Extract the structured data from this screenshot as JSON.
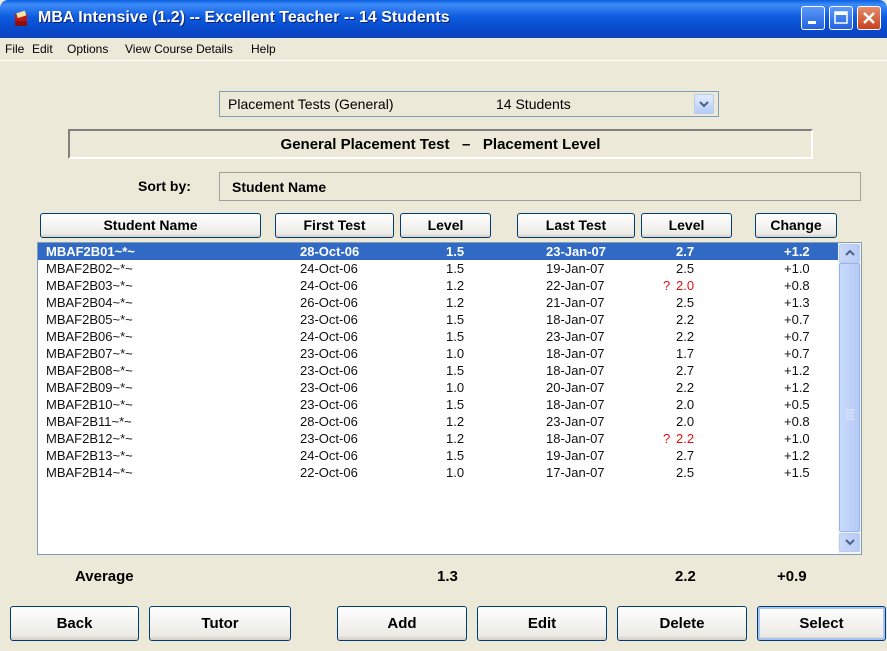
{
  "window": {
    "title": "MBA Intensive (1.2) -- Excellent Teacher -- 14 Students",
    "icon": "app-book-icon"
  },
  "menu": [
    "File",
    "Edit",
    "Options",
    "View Course Details",
    "Help"
  ],
  "dropdown": {
    "selected_test": "Placement Tests (General)",
    "selected_count": "14 Students"
  },
  "header": {
    "test_name": "General Placement Test",
    "separator": "–",
    "measure": "Placement Level"
  },
  "sort": {
    "label": "Sort by:",
    "value": "Student Name"
  },
  "columns": {
    "student_name": "Student Name",
    "first_test": "First Test",
    "level_first": "Level",
    "last_test": "Last Test",
    "level_last": "Level",
    "change": "Change"
  },
  "rows": [
    {
      "name": "MBAF2B01~*~",
      "first_test": "28-Oct-06",
      "level_first": "1.5",
      "last_test": "23-Jan-07",
      "flag": "",
      "level_last": "2.7",
      "change": "+1.2"
    },
    {
      "name": "MBAF2B02~*~",
      "first_test": "24-Oct-06",
      "level_first": "1.5",
      "last_test": "19-Jan-07",
      "flag": "",
      "level_last": "2.5",
      "change": "+1.0"
    },
    {
      "name": "MBAF2B03~*~",
      "first_test": "24-Oct-06",
      "level_first": "1.2",
      "last_test": "22-Jan-07",
      "flag": "?",
      "level_last": "2.0",
      "change": "+0.8"
    },
    {
      "name": "MBAF2B04~*~",
      "first_test": "26-Oct-06",
      "level_first": "1.2",
      "last_test": "21-Jan-07",
      "flag": "",
      "level_last": "2.5",
      "change": "+1.3"
    },
    {
      "name": "MBAF2B05~*~",
      "first_test": "23-Oct-06",
      "level_first": "1.5",
      "last_test": "18-Jan-07",
      "flag": "",
      "level_last": "2.2",
      "change": "+0.7"
    },
    {
      "name": "MBAF2B06~*~",
      "first_test": "24-Oct-06",
      "level_first": "1.5",
      "last_test": "23-Jan-07",
      "flag": "",
      "level_last": "2.2",
      "change": "+0.7"
    },
    {
      "name": "MBAF2B07~*~",
      "first_test": "23-Oct-06",
      "level_first": "1.0",
      "last_test": "18-Jan-07",
      "flag": "",
      "level_last": "1.7",
      "change": "+0.7"
    },
    {
      "name": "MBAF2B08~*~",
      "first_test": "23-Oct-06",
      "level_first": "1.5",
      "last_test": "18-Jan-07",
      "flag": "",
      "level_last": "2.7",
      "change": "+1.2"
    },
    {
      "name": "MBAF2B09~*~",
      "first_test": "23-Oct-06",
      "level_first": "1.0",
      "last_test": "20-Jan-07",
      "flag": "",
      "level_last": "2.2",
      "change": "+1.2"
    },
    {
      "name": "MBAF2B10~*~",
      "first_test": "23-Oct-06",
      "level_first": "1.5",
      "last_test": "18-Jan-07",
      "flag": "",
      "level_last": "2.0",
      "change": "+0.5"
    },
    {
      "name": "MBAF2B11~*~",
      "first_test": "28-Oct-06",
      "level_first": "1.2",
      "last_test": "23-Jan-07",
      "flag": "",
      "level_last": "2.0",
      "change": "+0.8"
    },
    {
      "name": "MBAF2B12~*~",
      "first_test": "23-Oct-06",
      "level_first": "1.2",
      "last_test": "18-Jan-07",
      "flag": "?",
      "level_last": "2.2",
      "change": "+1.0"
    },
    {
      "name": "MBAF2B13~*~",
      "first_test": "24-Oct-06",
      "level_first": "1.5",
      "last_test": "19-Jan-07",
      "flag": "",
      "level_last": "2.7",
      "change": "+1.2"
    },
    {
      "name": "MBAF2B14~*~",
      "first_test": "22-Oct-06",
      "level_first": "1.0",
      "last_test": "17-Jan-07",
      "flag": "",
      "level_last": "2.5",
      "change": "+1.5"
    }
  ],
  "selected_row": 0,
  "summary": {
    "label": "Average",
    "level_first": "1.3",
    "level_last": "2.2",
    "change": "+0.9"
  },
  "buttons": {
    "back": "Back",
    "tutor": "Tutor",
    "add": "Add",
    "edit": "Edit",
    "delete": "Delete",
    "select": "Select"
  },
  "colors": {
    "selection": "#316AC5",
    "flag": "#E01010",
    "titlebar": "#0A5FE0"
  }
}
